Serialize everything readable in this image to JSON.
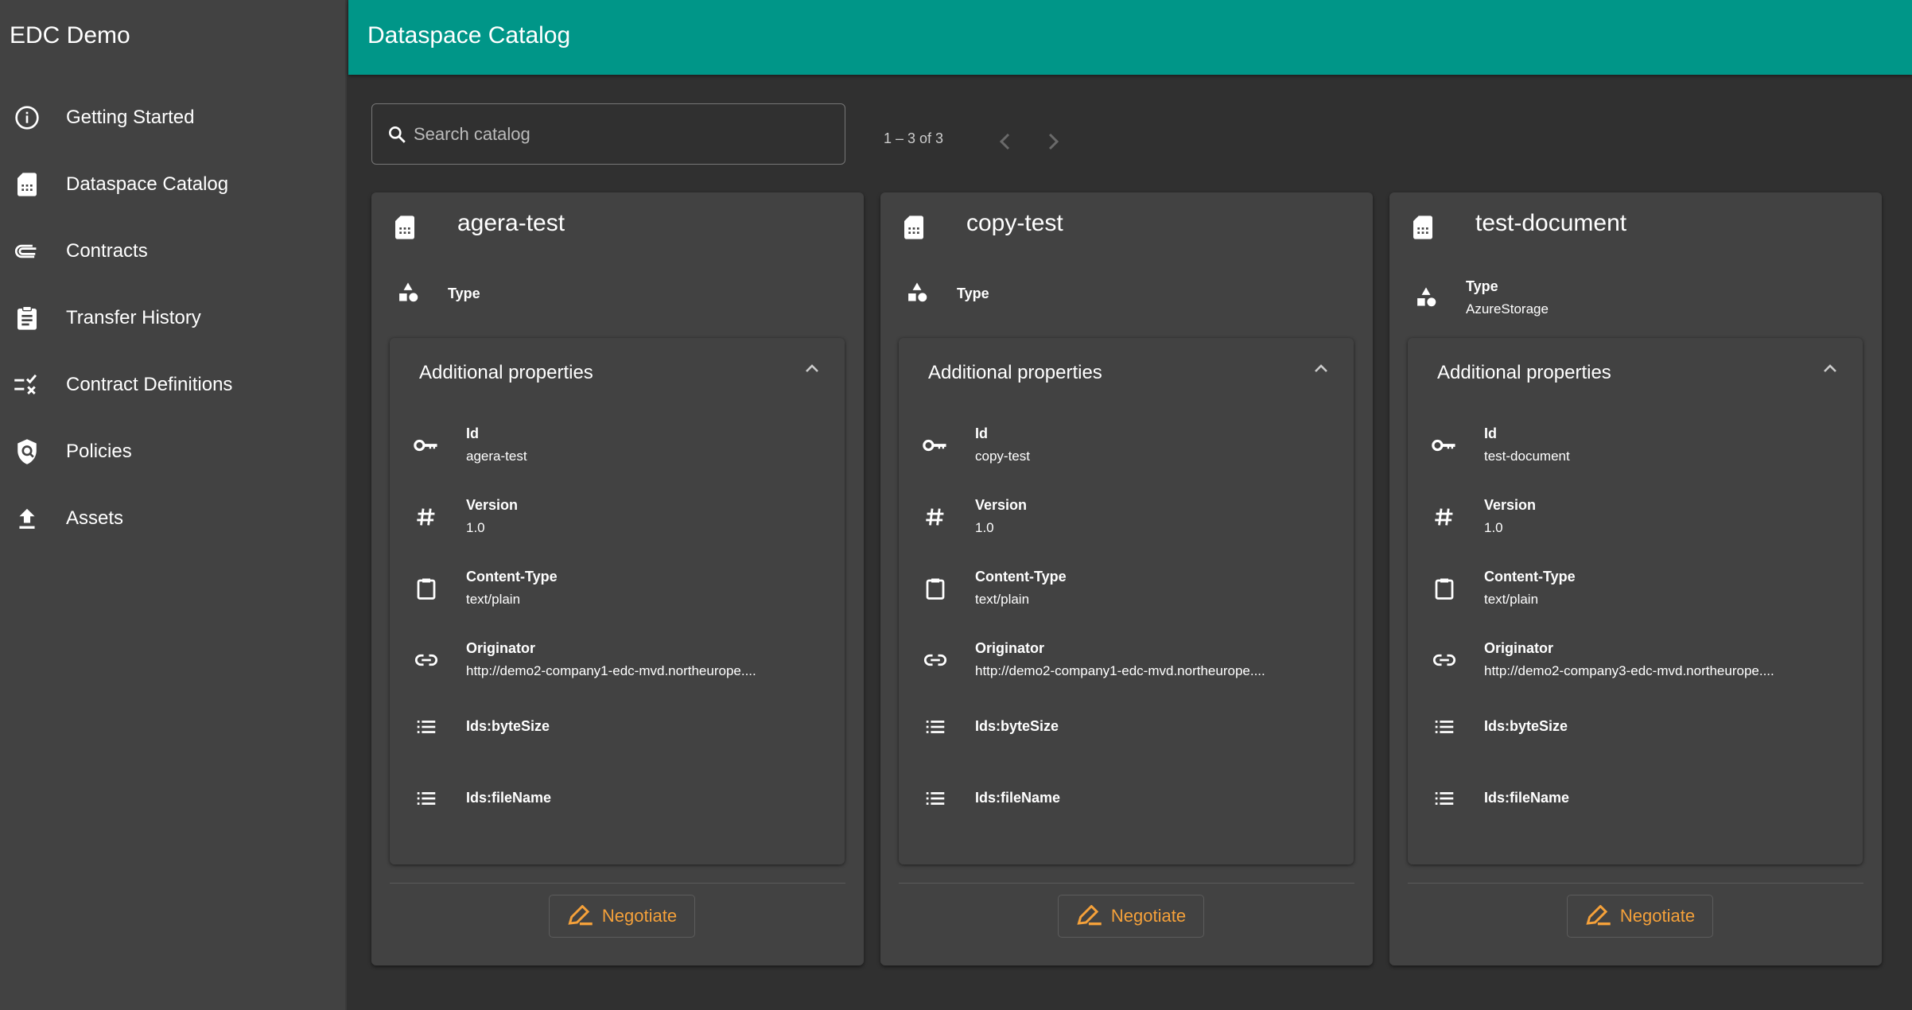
{
  "app_title": "EDC Demo",
  "sidebar": {
    "items": [
      {
        "label": "Getting Started",
        "icon": "info-icon"
      },
      {
        "label": "Dataspace Catalog",
        "icon": "sim-card-icon"
      },
      {
        "label": "Contracts",
        "icon": "paperclip-icon"
      },
      {
        "label": "Transfer History",
        "icon": "clipboard-list-icon"
      },
      {
        "label": "Contract Definitions",
        "icon": "rule-icon"
      },
      {
        "label": "Policies",
        "icon": "policy-shield-icon"
      },
      {
        "label": "Assets",
        "icon": "upload-icon"
      }
    ]
  },
  "header": {
    "title": "Dataspace Catalog"
  },
  "search": {
    "placeholder": "Search catalog",
    "value": ""
  },
  "pagination": {
    "range": "1 – 3 of 3"
  },
  "colors": {
    "header": "#009688",
    "accent": "#f5a13a",
    "sidebar": "#424242",
    "background": "#303030"
  },
  "labels": {
    "type": "Type",
    "additional": "Additional properties",
    "negotiate": "Negotiate"
  },
  "cards": [
    {
      "title": "agera-test",
      "type": "",
      "props": [
        {
          "key": "Id",
          "value": "agera-test",
          "icon": "key-icon"
        },
        {
          "key": "Version",
          "value": "1.0",
          "icon": "hash-icon"
        },
        {
          "key": "Content-Type",
          "value": "text/plain",
          "icon": "clipboard-icon"
        },
        {
          "key": "Originator",
          "value": "http://demo2-company1-edc-mvd.northeurope....",
          "icon": "link-icon"
        },
        {
          "key": "Ids:byteSize",
          "value": "",
          "icon": "list-icon"
        },
        {
          "key": "Ids:fileName",
          "value": "",
          "icon": "list-icon"
        }
      ]
    },
    {
      "title": "copy-test",
      "type": "",
      "props": [
        {
          "key": "Id",
          "value": "copy-test",
          "icon": "key-icon"
        },
        {
          "key": "Version",
          "value": "1.0",
          "icon": "hash-icon"
        },
        {
          "key": "Content-Type",
          "value": "text/plain",
          "icon": "clipboard-icon"
        },
        {
          "key": "Originator",
          "value": "http://demo2-company1-edc-mvd.northeurope....",
          "icon": "link-icon"
        },
        {
          "key": "Ids:byteSize",
          "value": "",
          "icon": "list-icon"
        },
        {
          "key": "Ids:fileName",
          "value": "",
          "icon": "list-icon"
        }
      ]
    },
    {
      "title": "test-document",
      "type": "AzureStorage",
      "props": [
        {
          "key": "Id",
          "value": "test-document",
          "icon": "key-icon"
        },
        {
          "key": "Version",
          "value": "1.0",
          "icon": "hash-icon"
        },
        {
          "key": "Content-Type",
          "value": "text/plain",
          "icon": "clipboard-icon"
        },
        {
          "key": "Originator",
          "value": "http://demo2-company3-edc-mvd.northeurope....",
          "icon": "link-icon"
        },
        {
          "key": "Ids:byteSize",
          "value": "",
          "icon": "list-icon"
        },
        {
          "key": "Ids:fileName",
          "value": "",
          "icon": "list-icon"
        }
      ]
    }
  ]
}
